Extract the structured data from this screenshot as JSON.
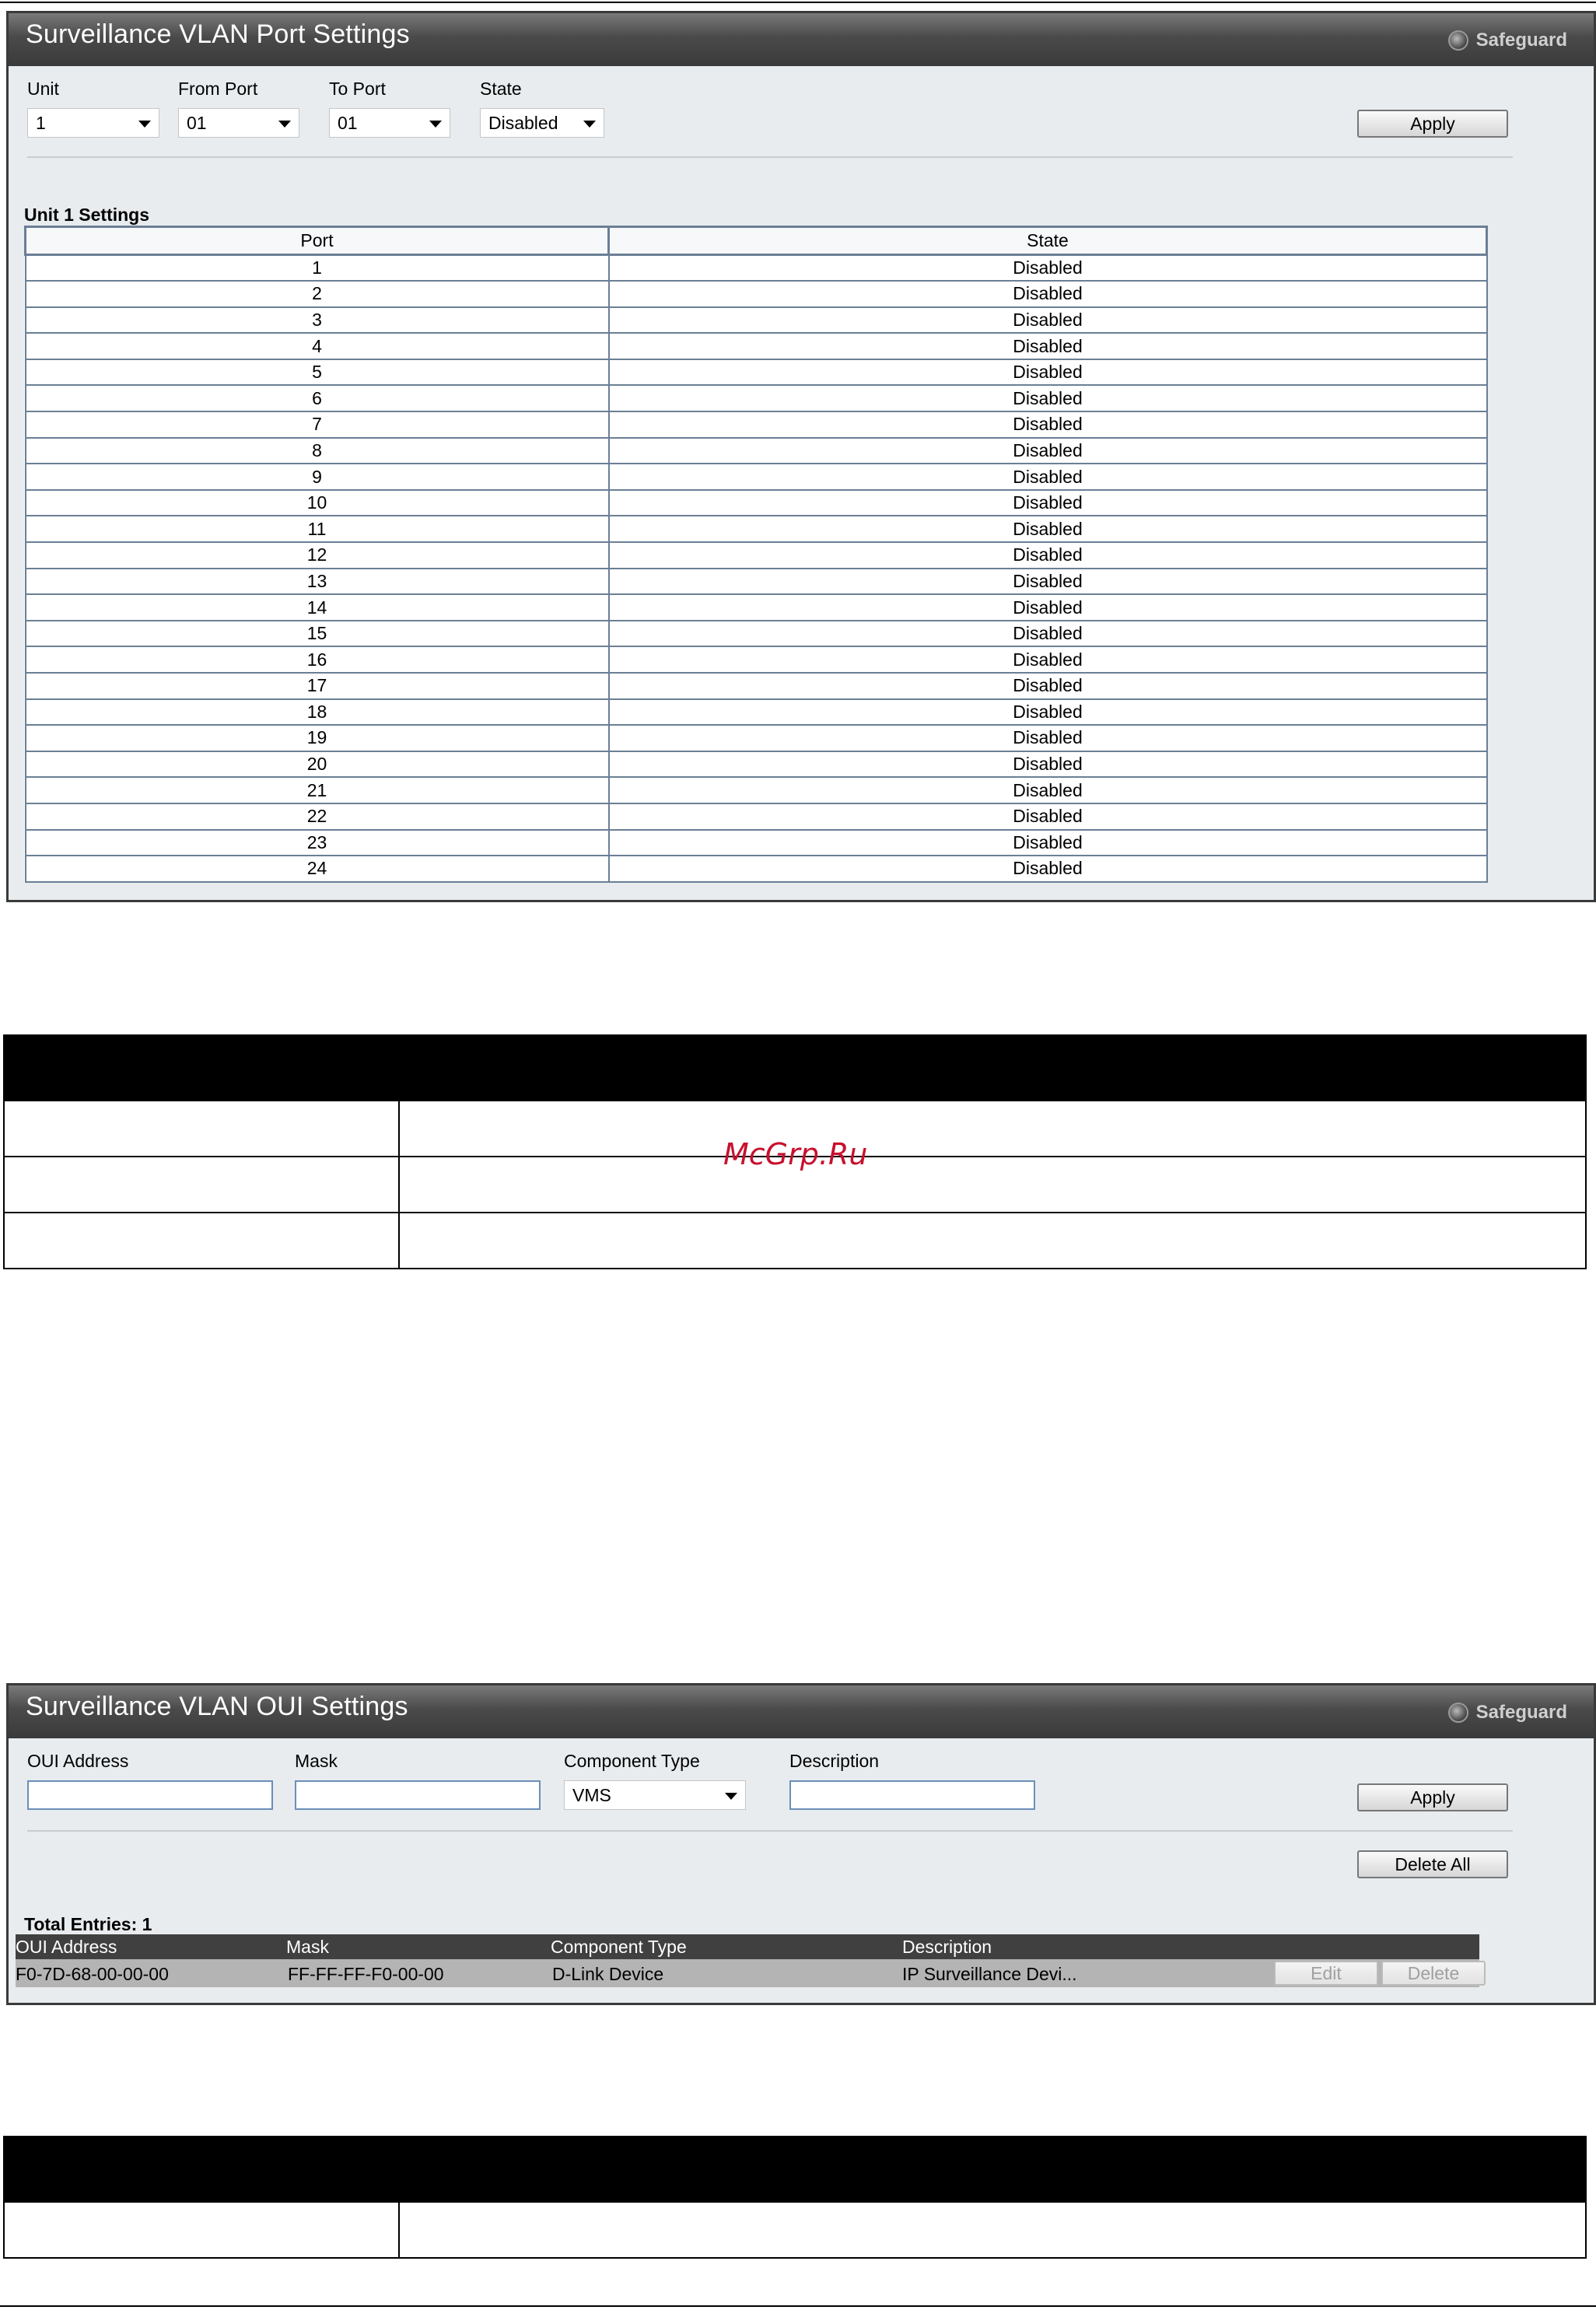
{
  "port_panel": {
    "title": "Surveillance VLAN Port Settings",
    "safeguard_label": "Safeguard",
    "unit_label": "Unit",
    "unit_value": "1",
    "from_port_label": "From Port",
    "from_port_value": "01",
    "to_port_label": "To Port",
    "to_port_value": "01",
    "state_label": "State",
    "state_value": "Disabled",
    "apply_label": "Apply",
    "settings_heading": "Unit 1 Settings",
    "table_headers": [
      "Port",
      "State"
    ],
    "rows": [
      {
        "port": "1",
        "state": "Disabled"
      },
      {
        "port": "2",
        "state": "Disabled"
      },
      {
        "port": "3",
        "state": "Disabled"
      },
      {
        "port": "4",
        "state": "Disabled"
      },
      {
        "port": "5",
        "state": "Disabled"
      },
      {
        "port": "6",
        "state": "Disabled"
      },
      {
        "port": "7",
        "state": "Disabled"
      },
      {
        "port": "8",
        "state": "Disabled"
      },
      {
        "port": "9",
        "state": "Disabled"
      },
      {
        "port": "10",
        "state": "Disabled"
      },
      {
        "port": "11",
        "state": "Disabled"
      },
      {
        "port": "12",
        "state": "Disabled"
      },
      {
        "port": "13",
        "state": "Disabled"
      },
      {
        "port": "14",
        "state": "Disabled"
      },
      {
        "port": "15",
        "state": "Disabled"
      },
      {
        "port": "16",
        "state": "Disabled"
      },
      {
        "port": "17",
        "state": "Disabled"
      },
      {
        "port": "18",
        "state": "Disabled"
      },
      {
        "port": "19",
        "state": "Disabled"
      },
      {
        "port": "20",
        "state": "Disabled"
      },
      {
        "port": "21",
        "state": "Disabled"
      },
      {
        "port": "22",
        "state": "Disabled"
      },
      {
        "port": "23",
        "state": "Disabled"
      },
      {
        "port": "24",
        "state": "Disabled"
      }
    ]
  },
  "watermark": "McGrp.Ru",
  "oui_panel": {
    "title": "Surveillance VLAN OUI Settings",
    "safeguard_label": "Safeguard",
    "oui_address_label": "OUI Address",
    "mask_label": "Mask",
    "component_type_label": "Component Type",
    "component_type_value": "VMS",
    "description_label": "Description",
    "apply_label": "Apply",
    "delete_all_label": "Delete All",
    "total_entries": "Total Entries: 1",
    "table_headers": [
      "OUI Address",
      "Mask",
      "Component Type",
      "Description"
    ],
    "entry": {
      "oui_address": "F0-7D-68-00-00-00",
      "mask": "FF-FF-FF-F0-00-00",
      "component_type": "D-Link Device",
      "description": "IP Surveillance Devi...",
      "edit_label": "Edit",
      "delete_label": "Delete"
    }
  },
  "colors": {
    "panel_bg": "#e8ecef",
    "title_bar": "#4a4a4a",
    "table_border": "#6a7f95",
    "oui_header": "#404040",
    "oui_row": "#b4b4b4",
    "watermark": "#c8102e"
  }
}
